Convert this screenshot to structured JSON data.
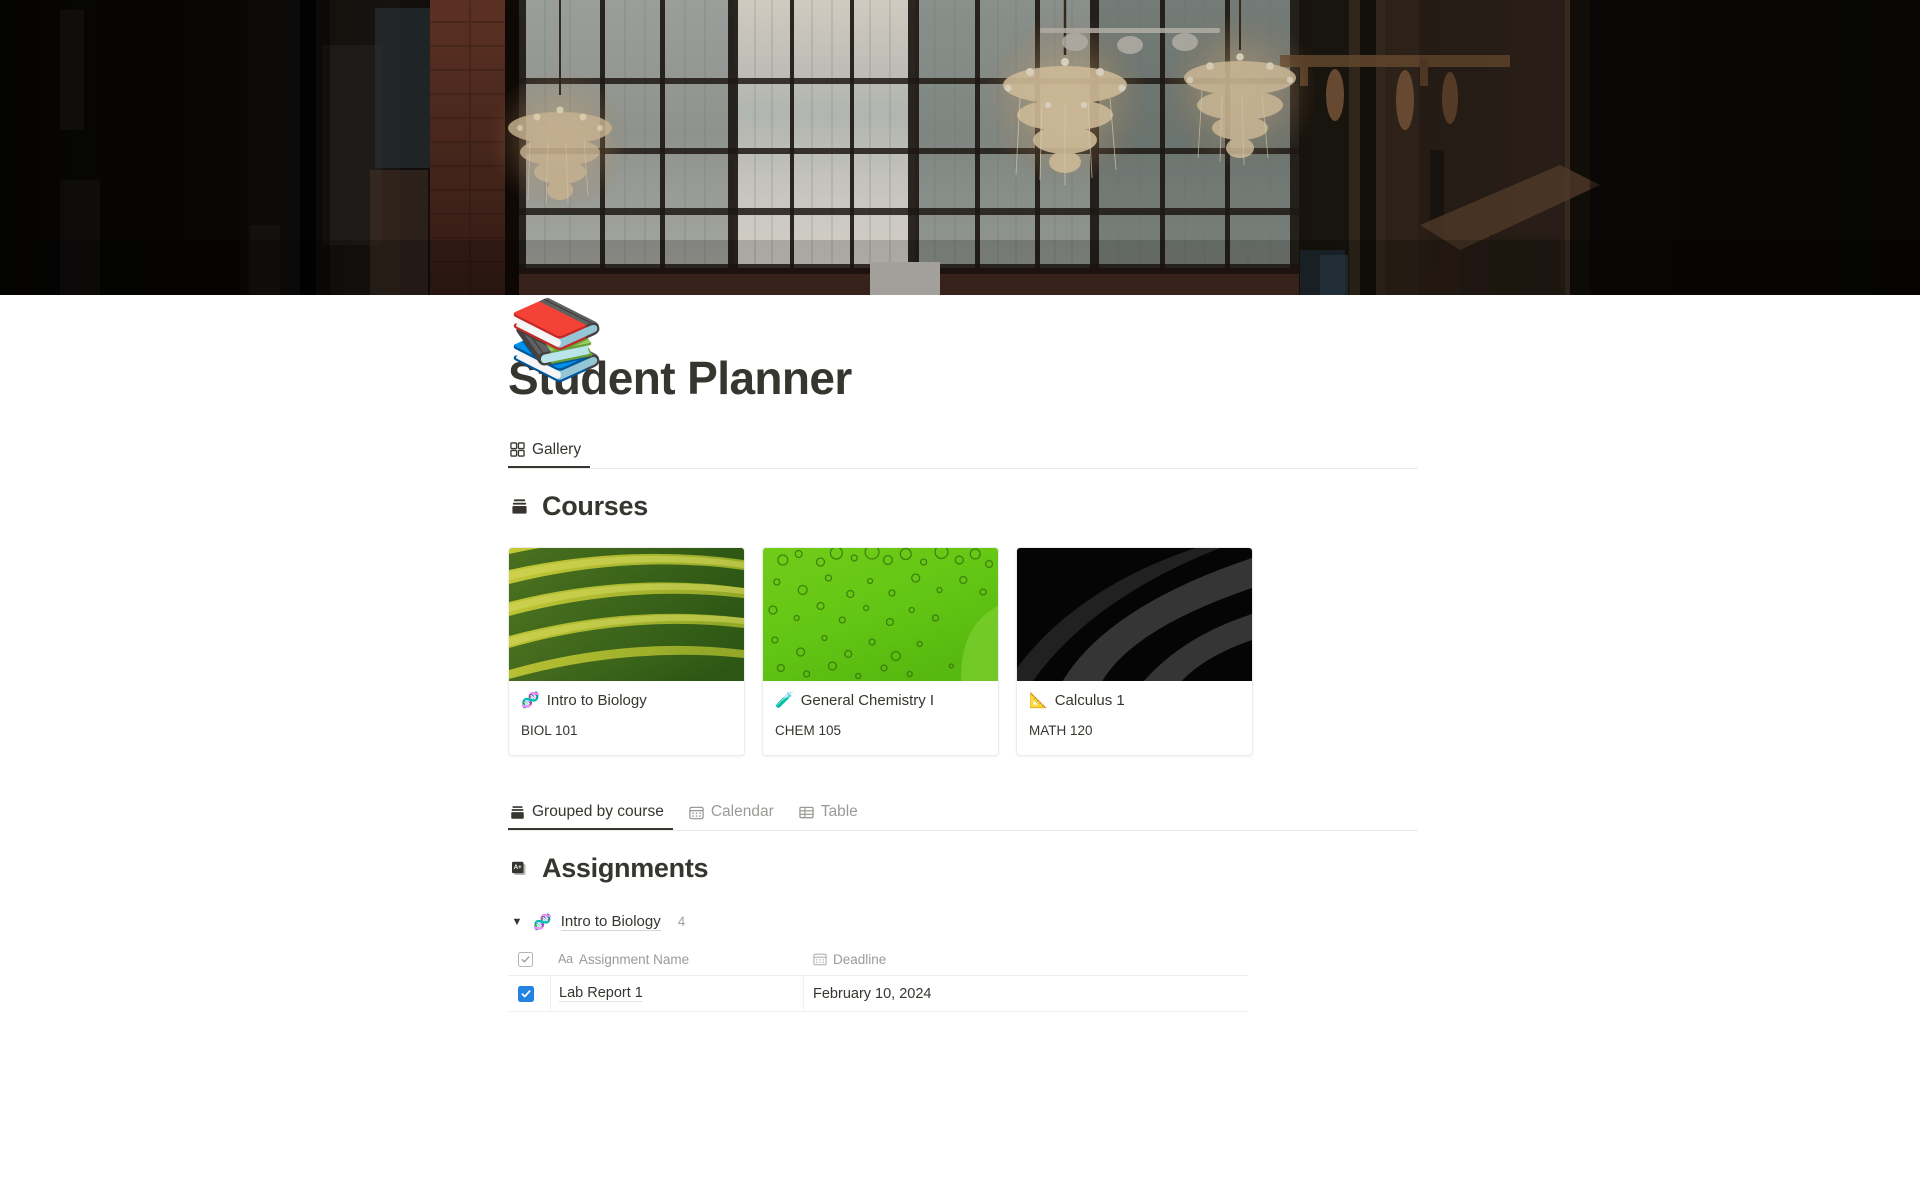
{
  "header": {
    "banner_alt": "industrial loft interior with tall windows and chandeliers",
    "page_icon": "📚",
    "title": "Student Planner"
  },
  "view_tabs": [
    {
      "label": "Gallery",
      "icon": "gallery-grid-icon",
      "active": true
    }
  ],
  "courses_section": {
    "icon": "database-icon",
    "title": "Courses",
    "cards": [
      {
        "emoji": "🧬",
        "title": "Intro to Biology",
        "code": "BIOL 101",
        "cover": "green-fern-stripes"
      },
      {
        "emoji": "🧪",
        "title": "General Chemistry I",
        "code": "CHEM 105",
        "cover": "green-bubbles"
      },
      {
        "emoji": "📐",
        "title": "Calculus 1",
        "code": "MATH 120",
        "cover": "black-curves"
      }
    ]
  },
  "assignment_tabs": [
    {
      "label": "Grouped by course",
      "icon": "database-icon",
      "active": true
    },
    {
      "label": "Calendar",
      "icon": "calendar-icon",
      "active": false
    },
    {
      "label": "Table",
      "icon": "table-icon",
      "active": false
    }
  ],
  "assignments_section": {
    "icon": "assignment-card-icon",
    "title": "Assignments",
    "group": {
      "caret": "▼",
      "emoji": "🧬",
      "name": "Intro to Biology",
      "count": "4"
    },
    "columns": {
      "checkbox": "",
      "name_type": "Aa",
      "name": "Assignment Name",
      "deadline": "Deadline"
    },
    "rows": [
      {
        "done": true,
        "name": "Lab Report 1",
        "deadline": "February 10, 2024"
      }
    ]
  },
  "colors": {
    "text": "#37352f",
    "muted": "#9b9a97",
    "accent_blue": "#2383e2",
    "border": "#ecebea"
  }
}
